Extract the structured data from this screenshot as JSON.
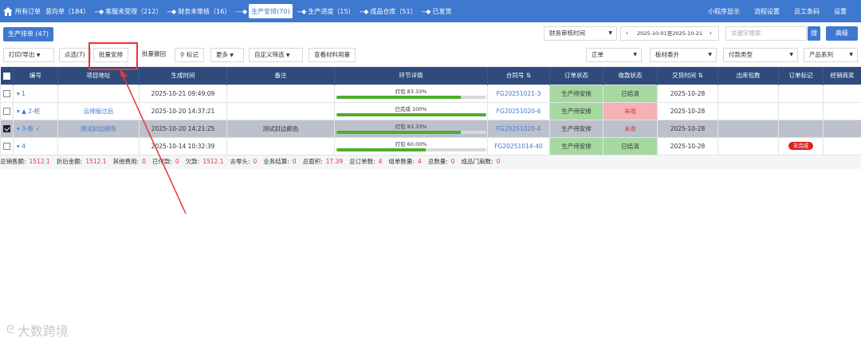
{
  "topnav": {
    "items": [
      {
        "label": "所有订单",
        "arrow": ""
      },
      {
        "label": "意向单（184）",
        "arrow": ""
      },
      {
        "label": "客服未受理（212）",
        "arrow": "---◆"
      },
      {
        "label": "财务未审核（16）",
        "arrow": "---◆"
      },
      {
        "label": "生产安排(70)",
        "arrow": "---◆"
      },
      {
        "label": "生产进度（15）",
        "arrow": "---◆"
      },
      {
        "label": "成品仓库（51）",
        "arrow": "---◆"
      },
      {
        "label": "已发货",
        "arrow": "---◆"
      }
    ],
    "right": [
      "小程序显示",
      "流程设置",
      "员工条码",
      "设置"
    ]
  },
  "tab": {
    "label": "生产排单 (47)"
  },
  "filters": {
    "date_type": "财务审核时间",
    "date_range": "2025-10-01至2025-10-21",
    "prev": "‹",
    "next": "›",
    "search_placeholder": "关键字搜索",
    "search_btn": "搜",
    "advanced_btn": "高级"
  },
  "toolbar": {
    "print": "打印/导出",
    "pick": "点选(7)",
    "batch_schedule": "批量安排",
    "batch_revoke": "批量撤回",
    "mark": "标记",
    "more": "更多",
    "custom_filter": "自定义筛选",
    "material": "查看材料用量",
    "order_type": "正单",
    "outsource": "板材委外",
    "pay_type": "付款类型",
    "product_series": "产品系列"
  },
  "table": {
    "headers": [
      "编号",
      "项目地址",
      "生成时间",
      "备注",
      "环节详情",
      "合同号",
      "订单状态",
      "收款状态",
      "交货时间",
      "出库包数",
      "订单标记",
      "经销商奖"
    ],
    "rows": [
      {
        "code": "1",
        "address": "",
        "time": "2025-10-21 09:49:09",
        "note": "",
        "prog_label": "打包 83.33%",
        "progress": 83.33,
        "contract": "FG20251021-3",
        "status": "生产待安排",
        "pay": "已结清",
        "pay_kind": "green",
        "delivery": "2025-10-28",
        "packs": "",
        "tag": "",
        "checked": false,
        "selected": false
      },
      {
        "code": "▲ 2-柜",
        "address": "云排版过后",
        "time": "2025-10-20 14:37:21",
        "note": "",
        "prog_label": "已完成 100%",
        "progress": 100,
        "contract": "FG20251020-6",
        "status": "生产待安排",
        "pay": "未收",
        "pay_kind": "pink",
        "delivery": "2025-10-28",
        "packs": "",
        "tag": "",
        "checked": false,
        "selected": false
      },
      {
        "code": "3-柜 ✓",
        "address": "测试封边颜色",
        "time": "2025-10-20 14:21:25",
        "note": "测试封边颜色",
        "prog_label": "打包 83.33%",
        "progress": 83.33,
        "contract": "FG20251020-4",
        "status": "生产待安排",
        "pay": "未收",
        "pay_kind": "pink",
        "delivery": "2025-10-28",
        "packs": "",
        "tag": "",
        "checked": true,
        "selected": true
      },
      {
        "code": "4",
        "address": "",
        "time": "2025-10-14 10:32:39",
        "note": "",
        "prog_label": "打包 60.00%",
        "progress": 60,
        "contract": "FG20251014-40",
        "status": "生产待安排",
        "pay": "已结清",
        "pay_kind": "green",
        "delivery": "2025-10-28",
        "packs": "",
        "tag": "未完成",
        "checked": false,
        "selected": false
      }
    ]
  },
  "summary": [
    {
      "label": "总销售额:",
      "value": "1512.1"
    },
    {
      "label": "折后金额:",
      "value": "1512.1"
    },
    {
      "label": "其他费用:",
      "value": "0"
    },
    {
      "label": "已付款:",
      "value": "0"
    },
    {
      "label": "欠款:",
      "value": "1512.1"
    },
    {
      "label": "去零头:",
      "value": "0"
    },
    {
      "label": "业务结算:",
      "value": "0"
    },
    {
      "label": "总面积:",
      "value": "17.39"
    },
    {
      "label": "总订单数:",
      "value": "4"
    },
    {
      "label": "组单数量:",
      "value": "4"
    },
    {
      "label": "总数量:",
      "value": "0"
    },
    {
      "label": "成品门扇数:",
      "value": "0"
    }
  ],
  "watermark": "大数跨境",
  "colors": {
    "primary": "#3f78cf",
    "header": "#2f4b7c",
    "accent_red": "#e8353b"
  }
}
